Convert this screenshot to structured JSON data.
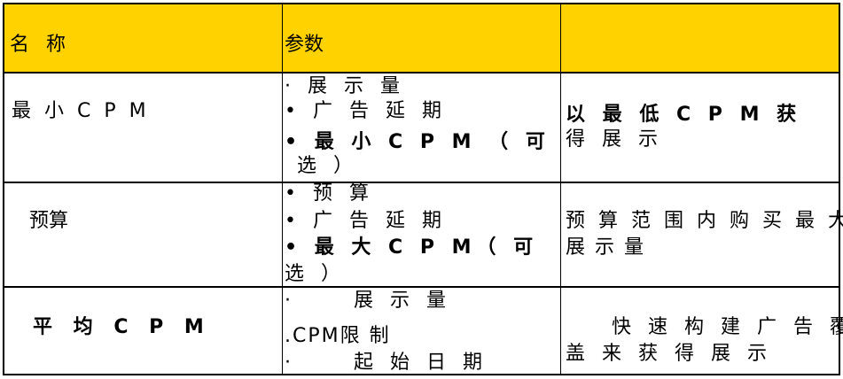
{
  "header": {
    "name": "名 称",
    "params": "参数",
    "desc": ""
  },
  "rows": [
    {
      "name": "最 小 C P M",
      "params": [
        "· 展 示 量",
        "• 广 告 延 期",
        "• 最 小 C P M （ 可",
        "选 ）"
      ],
      "desc": [
        "以 最 低 C P M  获",
        "得 展 示"
      ]
    },
    {
      "name": "预算",
      "params": [
        "• 预 算",
        "• 广 告 延 期",
        "• 最 大 C P M（  可",
        "选 ）"
      ],
      "desc": [
        "预 算 范 围 内 购 买 最 大",
        "展 示 量"
      ]
    },
    {
      "name": "平 均 C P M",
      "params": [
        "·     展 示 量",
        ".CPM限 制",
        "·     起 始 日 期"
      ],
      "desc": [
        "    快 速 构 建 广 告 覆",
        "盖 来 获 得 展 示"
      ]
    }
  ],
  "colors": {
    "header_bg": "#FFD200",
    "border": "#000000"
  }
}
